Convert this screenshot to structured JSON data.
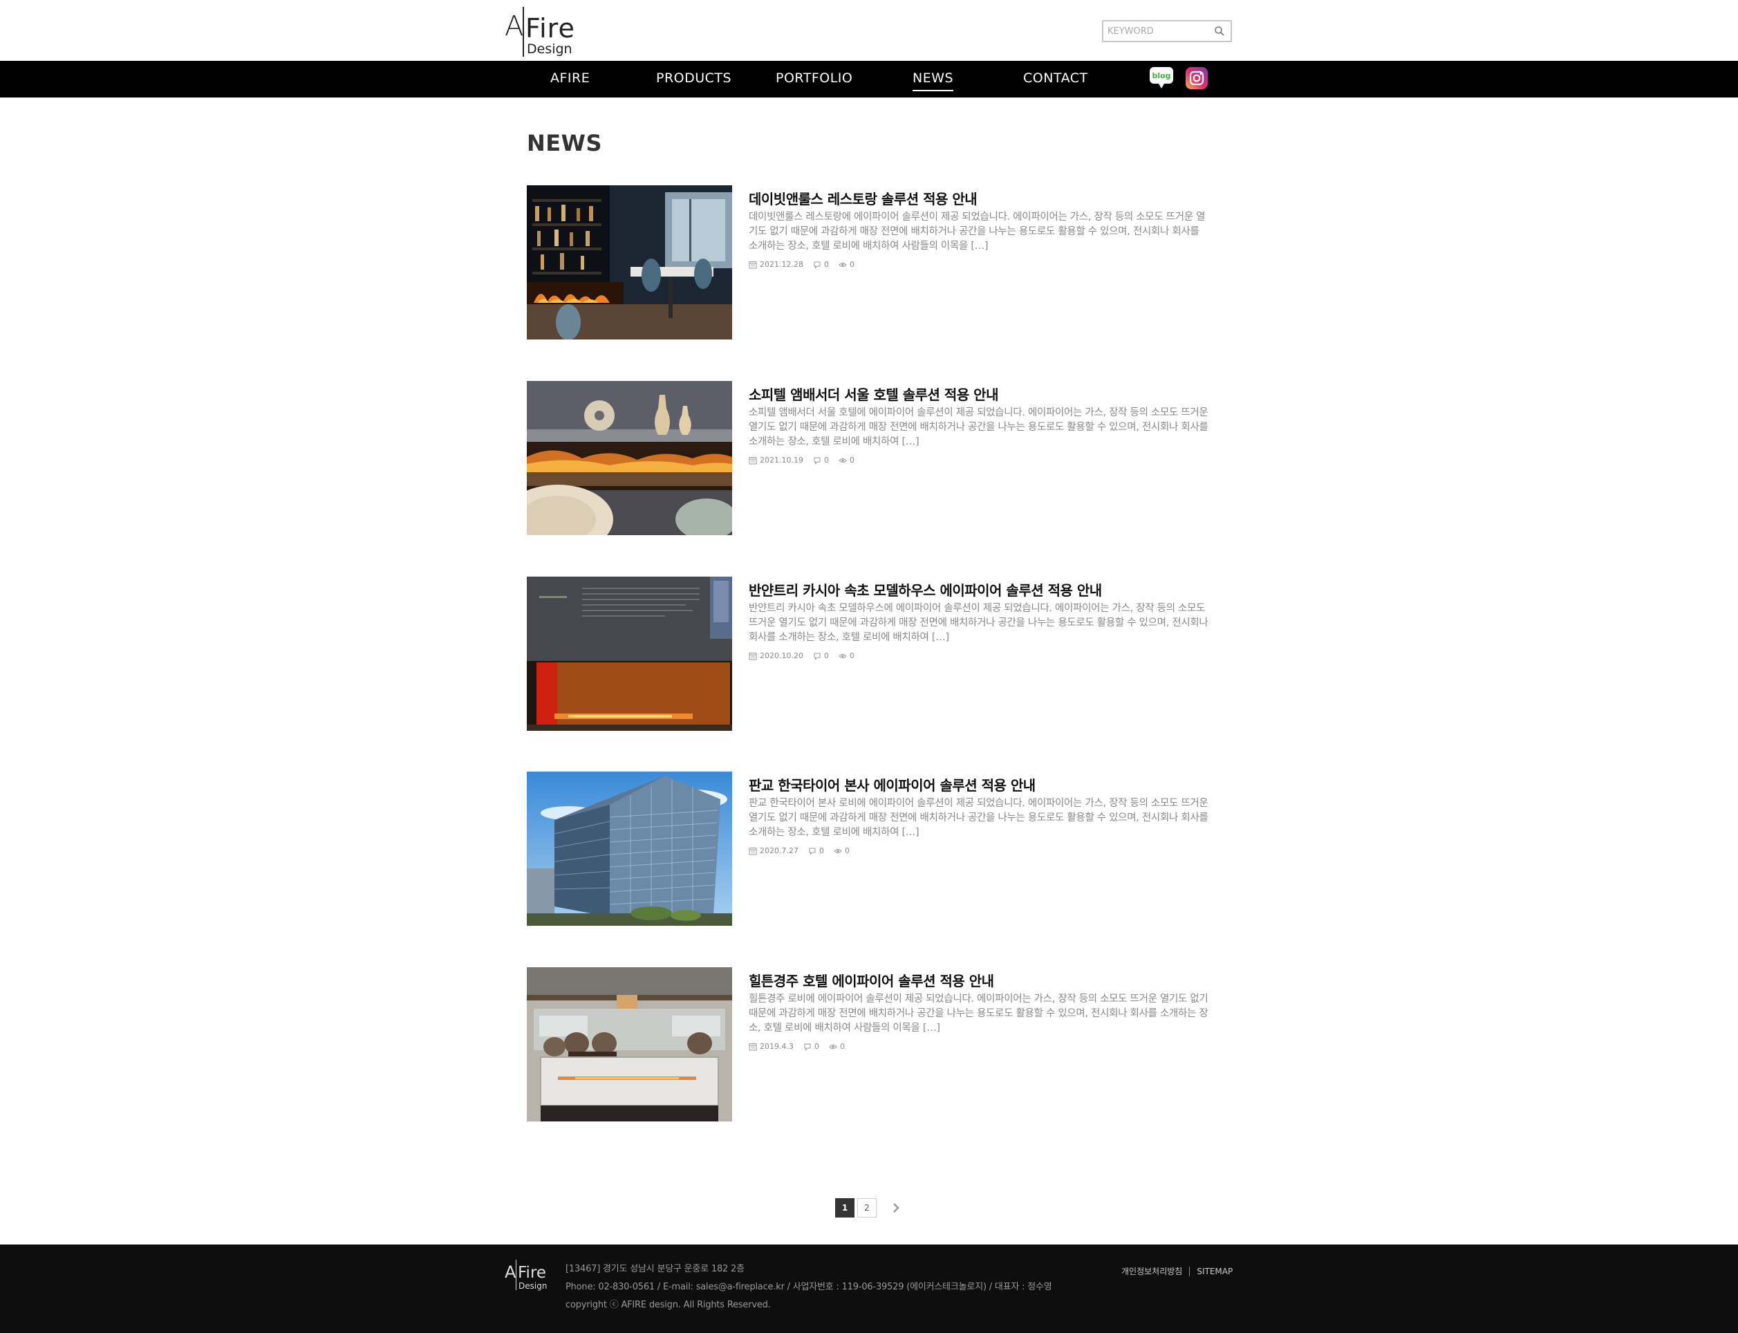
{
  "header": {
    "logo": {
      "a": "A",
      "fire": "Fire",
      "design": "Design"
    },
    "search_placeholder": "KEYWORD",
    "nav": [
      {
        "label": "AFIRE"
      },
      {
        "label": "PRODUCTS"
      },
      {
        "label": "PORTFOLIO"
      },
      {
        "label": "NEWS",
        "active": true
      },
      {
        "label": "CONTACT"
      }
    ],
    "social": {
      "blog_label": "blog"
    }
  },
  "main": {
    "title": "NEWS",
    "posts": [
      {
        "title": "데이빗앤룰스 레스토랑 솔루션 적용 안내",
        "excerpt": "데이빗앤룰스 레스토랑에 에이파이어 솔루션이 제공 되었습니다. 에이파이어는 가스, 장작 등의 소모도 뜨거운 열기도 없기 때문에 과감하게 매장 전면에 배치하거나 공간을 나누는 용도로도 활용할 수 있으며, 전시회나 회사를 소개하는 장소, 호텔 로비에 배치하여 사람들의 이목을 […]",
        "date": "2021.12.28",
        "comments": "0",
        "views": "0"
      },
      {
        "title": "소피텔 앰배서더 서울 호텔 솔루션 적용 안내",
        "excerpt": "소피텔 앰배서더 서울 호텔에 에이파이어 솔루션이 제공 되었습니다. 에이파이어는 가스, 장작 등의 소모도 뜨거운 열기도 없기 때문에 과감하게 매장 전면에 배치하거나 공간을 나누는 용도로도 활용할 수 있으며, 전시회나 회사를 소개하는 장소, 호텔 로비에 배치하여 […]",
        "date": "2021.10.19",
        "comments": "0",
        "views": "0"
      },
      {
        "title": "반얀트리 카시아 속초 모델하우스 에이파이어 솔루션 적용 안내",
        "excerpt": "반얀트리 카시아 속초 모델하우스에 에이파이어 솔루션이 제공 되었습니다. 에이파이어는 가스, 장작 등의 소모도 뜨거운 열기도 없기 때문에 과감하게 매장 전면에 배치하거나 공간을 나누는 용도로도 활용할 수 있으며, 전시회나 회사를 소개하는 장소, 호텔 로비에 배치하여 […]",
        "date": "2020.10.20",
        "comments": "0",
        "views": "0"
      },
      {
        "title": "판교 한국타이어 본사 에이파이어 솔루션 적용 안내",
        "excerpt": "판교 한국타이어 본사 로비에 에이파이어 솔루션이 제공 되었습니다. 에이파이어는 가스, 장작 등의 소모도 뜨거운 열기도 없기 때문에 과감하게 매장 전면에 배치하거나 공간을 나누는 용도로도 활용할 수 있으며, 전시회나 회사를 소개하는 장소, 호텔 로비에 배치하여 […]",
        "date": "2020.7.27",
        "comments": "0",
        "views": "0"
      },
      {
        "title": "힐튼경주 호텔 에이파이어 솔루션 적용 안내",
        "excerpt": "힐튼경주 로비에 에이파이어 솔루션이 제공 되었습니다. 에이파이어는 가스, 장작 등의 소모도 뜨거운 열기도 없기 때문에 과감하게 매장 전면에 배치하거나 공간을 나누는 용도로도 활용할 수 있으며, 전시회나 회사를 소개하는 장소, 호텔 로비에 배치하여 사람들의 이목을 […]",
        "date": "2019.4.3",
        "comments": "0",
        "views": "0"
      }
    ],
    "pagination": {
      "pages": [
        "1",
        "2"
      ],
      "current": "1"
    }
  },
  "footer": {
    "address": "[13467] 경기도 성남시 분당구 운중로 182 2층",
    "contact": "Phone: 02-830-0561 / E-mail: sales@a-fireplace.kr / 사업자번호 : 119-06-39529 (에이커스테크놀로지) / 대표자 : 정수영",
    "copyright": "copyright ⓒ AFIRE design. All Rights Reserved.",
    "links": {
      "privacy": "개인정보처리방침",
      "sitemap": "SITEMAP"
    }
  },
  "colors": {
    "nav_bg": "#000000",
    "footer_bg": "#0e0e0e",
    "active_page": "#333333"
  }
}
